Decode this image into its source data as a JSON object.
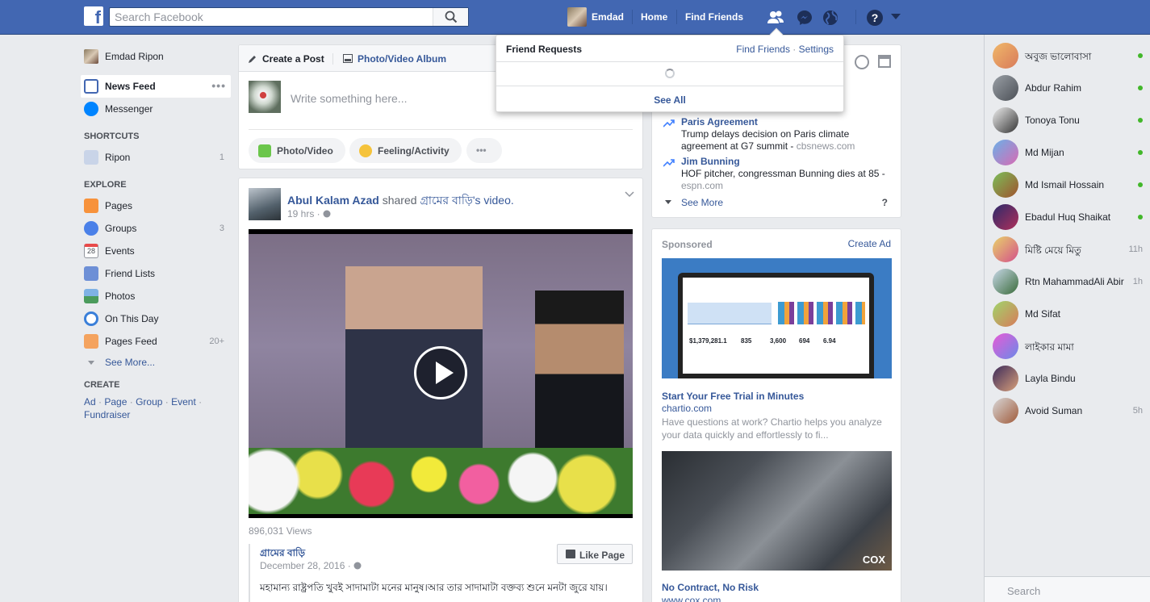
{
  "topbar": {
    "logo": "f",
    "search_placeholder": "Search Facebook",
    "profile_name": "Emdad",
    "home": "Home",
    "find_friends": "Find Friends",
    "icons": [
      "search-icon",
      "friend-requests-icon",
      "messenger-icon",
      "globe-icon",
      "help-icon",
      "caret-down-icon"
    ],
    "brand_color": "#4267b2"
  },
  "friend_requests": {
    "title": "Friend Requests",
    "find_friends": "Find Friends",
    "sep": "·",
    "settings": "Settings",
    "see_all": "See All"
  },
  "leftnav": {
    "profile": "Emdad Ripon",
    "news_feed": "News Feed",
    "dots": "•••",
    "messenger": "Messenger",
    "shortcuts_head": "SHORTCUTS",
    "shortcut_ripon": "Ripon",
    "shortcut_ripon_count": "1",
    "explore_head": "EXPLORE",
    "explore": [
      {
        "label": "Pages",
        "count": ""
      },
      {
        "label": "Groups",
        "count": "3"
      },
      {
        "label": "Events",
        "count": ""
      },
      {
        "label": "Friend Lists",
        "count": ""
      },
      {
        "label": "Photos",
        "count": ""
      },
      {
        "label": "On This Day",
        "count": ""
      },
      {
        "label": "Pages Feed",
        "count": "20+"
      }
    ],
    "events_day": "28",
    "see_more": "See More...",
    "create_head": "CREATE",
    "create_links": [
      "Ad",
      "Page",
      "Group",
      "Event",
      "Fundraiser"
    ],
    "create_sep": " · "
  },
  "composer": {
    "tab_post": "Create a Post",
    "tab_album": "Photo/Video Album",
    "placeholder": "Write something here...",
    "btn_photo": "Photo/Video",
    "btn_feeling": "Feeling/Activity",
    "btn_more": "•••"
  },
  "post": {
    "author": "Abul Kalam Azad",
    "action": " shared ",
    "page": "গ্রামের বাড়ি",
    "suffix": "'s video.",
    "time": "19 hrs · ",
    "views": "896,031 Views",
    "shared_page": "গ্রামের বাড়ি",
    "shared_date": "December 28, 2016 · ",
    "like_page": "Like Page",
    "shared_text": "মহামান্য রাষ্ট্রপতি খুবই সাদামাটা মনের মানুষ।আর তার সাদামাটা বক্তব্য শুনে মনটা জুরে যায়।"
  },
  "trending": {
    "items": [
      {
        "title": "Paris Agreement",
        "desc": "Trump delays decision on Paris climate agreement at G7 summit - ",
        "source": "cbsnews.com"
      },
      {
        "title": "Jim Bunning",
        "desc": "HOF pitcher, congressman Bunning dies at 85 - ",
        "source": "espn.com"
      }
    ],
    "see_more": "See More",
    "help": "?"
  },
  "sponsored": {
    "title": "Sponsored",
    "create_ad": "Create Ad",
    "ads": [
      {
        "title": "Start Your Free Trial in Minutes",
        "domain": "chartio.com",
        "desc": "Have questions at work? Chartio helps you analyze your data quickly and effortlessly to fi...",
        "image_text": [
          "$1,379,281.1",
          "835",
          "3,600",
          "694",
          "6.94"
        ]
      },
      {
        "title": "No Contract, No Risk",
        "domain": "www.cox.com",
        "image_mark": "COX"
      }
    ]
  },
  "chat": {
    "contacts": [
      {
        "name": "অবুজ ভালোবাসা",
        "status": "online",
        "time": ""
      },
      {
        "name": "Abdur Rahim",
        "status": "online",
        "time": ""
      },
      {
        "name": "Tonoya Tonu",
        "status": "online",
        "time": ""
      },
      {
        "name": "Md Mijan",
        "status": "online",
        "time": ""
      },
      {
        "name": "Md Ismail Hossain",
        "status": "online",
        "time": ""
      },
      {
        "name": "Ebadul Huq Shaikat",
        "status": "online",
        "time": ""
      },
      {
        "name": "মিষ্টি মেয়ে মিতু",
        "status": "away",
        "time": "11h"
      },
      {
        "name": "Rtn MahammadAli Abir",
        "status": "away",
        "time": "1h"
      },
      {
        "name": "Md Sifat",
        "status": "online",
        "time": ""
      },
      {
        "name": "লাইকার মামা",
        "status": "online",
        "time": ""
      },
      {
        "name": "Layla Bindu",
        "status": "online",
        "time": ""
      },
      {
        "name": "Avoid Suman",
        "status": "away",
        "time": "5h"
      }
    ],
    "search_placeholder": "Search"
  }
}
